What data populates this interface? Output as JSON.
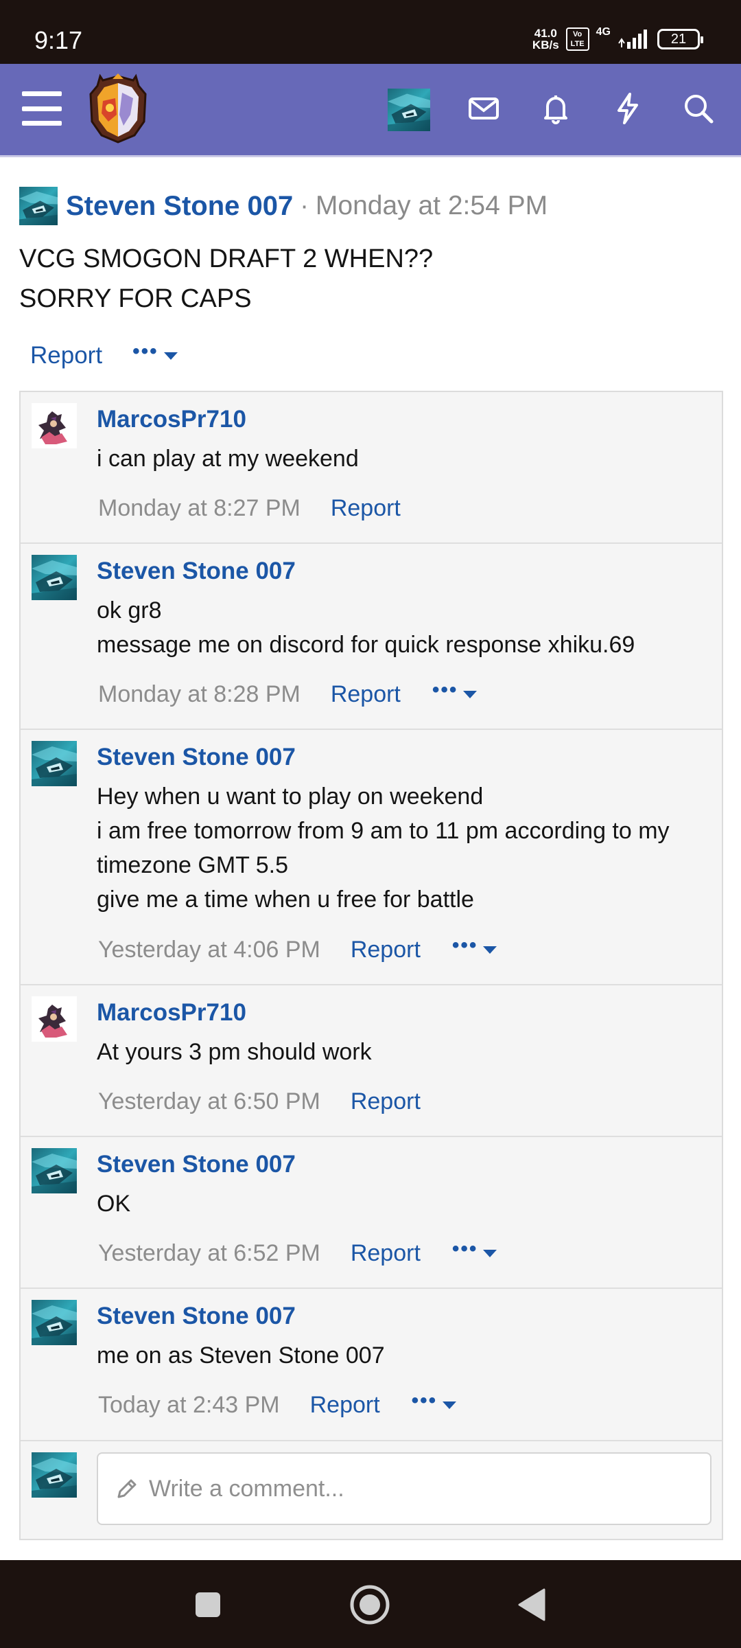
{
  "status_bar": {
    "time": "9:17",
    "speed_value": "41.0",
    "speed_unit": "KB/s",
    "volte": "Vo LTE",
    "network": "4G",
    "battery": "21"
  },
  "header": {
    "menu_icon": "hamburger-icon",
    "icons": [
      "mail-icon",
      "bell-icon",
      "bolt-icon",
      "search-icon"
    ],
    "colors": {
      "bar": "#6769b8",
      "link": "#1b56a6"
    }
  },
  "post": {
    "author": "Steven Stone 007",
    "separator": "·",
    "time": "Monday at 2:54 PM",
    "body_line1": "VCG SMOGON DRAFT 2 WHEN??",
    "body_line2": "SORRY FOR CAPS",
    "report_label": "Report",
    "more_label": "•••"
  },
  "comments": [
    {
      "author": "MarcosPr710",
      "lines": [
        "i can play at my weekend"
      ],
      "time": "Monday at 8:27 PM",
      "report": "Report"
    },
    {
      "author": "Steven Stone 007",
      "lines": [
        "ok gr8",
        "message me on discord for quick response xhiku.69"
      ],
      "time": "Monday at 8:28 PM",
      "report": "Report",
      "more": "•••"
    },
    {
      "author": "Steven Stone 007",
      "lines": [
        "Hey when u want to play on weekend",
        "i am free tomorrow from 9 am to 11 pm according to my",
        "timezone GMT 5.5",
        "give me a time when u free for battle"
      ],
      "time": "Yesterday at 4:06 PM",
      "report": "Report",
      "more": "•••"
    },
    {
      "author": "MarcosPr710",
      "lines": [
        "At yours 3 pm should work"
      ],
      "time": "Yesterday at 6:50 PM",
      "report": "Report"
    },
    {
      "author": "Steven Stone 007",
      "lines": [
        "OK"
      ],
      "time": "Yesterday at 6:52 PM",
      "report": "Report",
      "more": "•••"
    },
    {
      "author": "Steven Stone 007",
      "lines": [
        "me on as Steven Stone 007"
      ],
      "time": "Today at 2:43 PM",
      "report": "Report",
      "more": "•••"
    }
  ],
  "write_comment": {
    "placeholder": "Write a comment..."
  },
  "nav_bar": {
    "buttons": [
      "recent-apps-icon",
      "home-icon",
      "back-icon"
    ]
  }
}
